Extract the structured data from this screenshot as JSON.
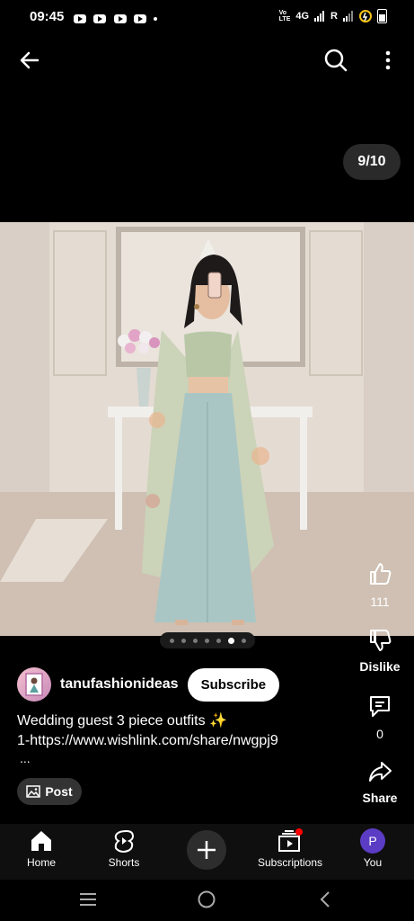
{
  "status_bar": {
    "time": "09:45",
    "network": "4G",
    "roaming": "R"
  },
  "top_bar": {
    "back_icon": "arrow-left-icon",
    "search_icon": "search-icon",
    "more_icon": "more-vertical-icon"
  },
  "carousel": {
    "counter": "9/10",
    "total_dots": 7,
    "active_dot": 6
  },
  "side_actions": {
    "like_count": "111",
    "dislike_label": "Dislike",
    "comment_count": "0",
    "share_label": "Share"
  },
  "channel": {
    "name": "tanufashionideas",
    "subscribe_label": "Subscribe"
  },
  "post": {
    "caption_line1": "Wedding guest 3 piece outfits ✨",
    "caption_line2": "1-https://www.wishlink.com/share/nwgpj9",
    "more": "...",
    "post_button_label": "Post"
  },
  "bottom_nav": {
    "items": [
      {
        "label": "Home",
        "icon": "home-icon"
      },
      {
        "label": "Shorts",
        "icon": "shorts-icon"
      },
      {
        "label": "",
        "icon": "create-icon"
      },
      {
        "label": "Subscriptions",
        "icon": "subscriptions-icon"
      },
      {
        "label": "You",
        "icon": "avatar",
        "avatar_letter": "P"
      }
    ]
  },
  "colors": {
    "background": "#000000",
    "avatar_purple": "#5b3cc4",
    "notification_red": "#ff0000"
  }
}
